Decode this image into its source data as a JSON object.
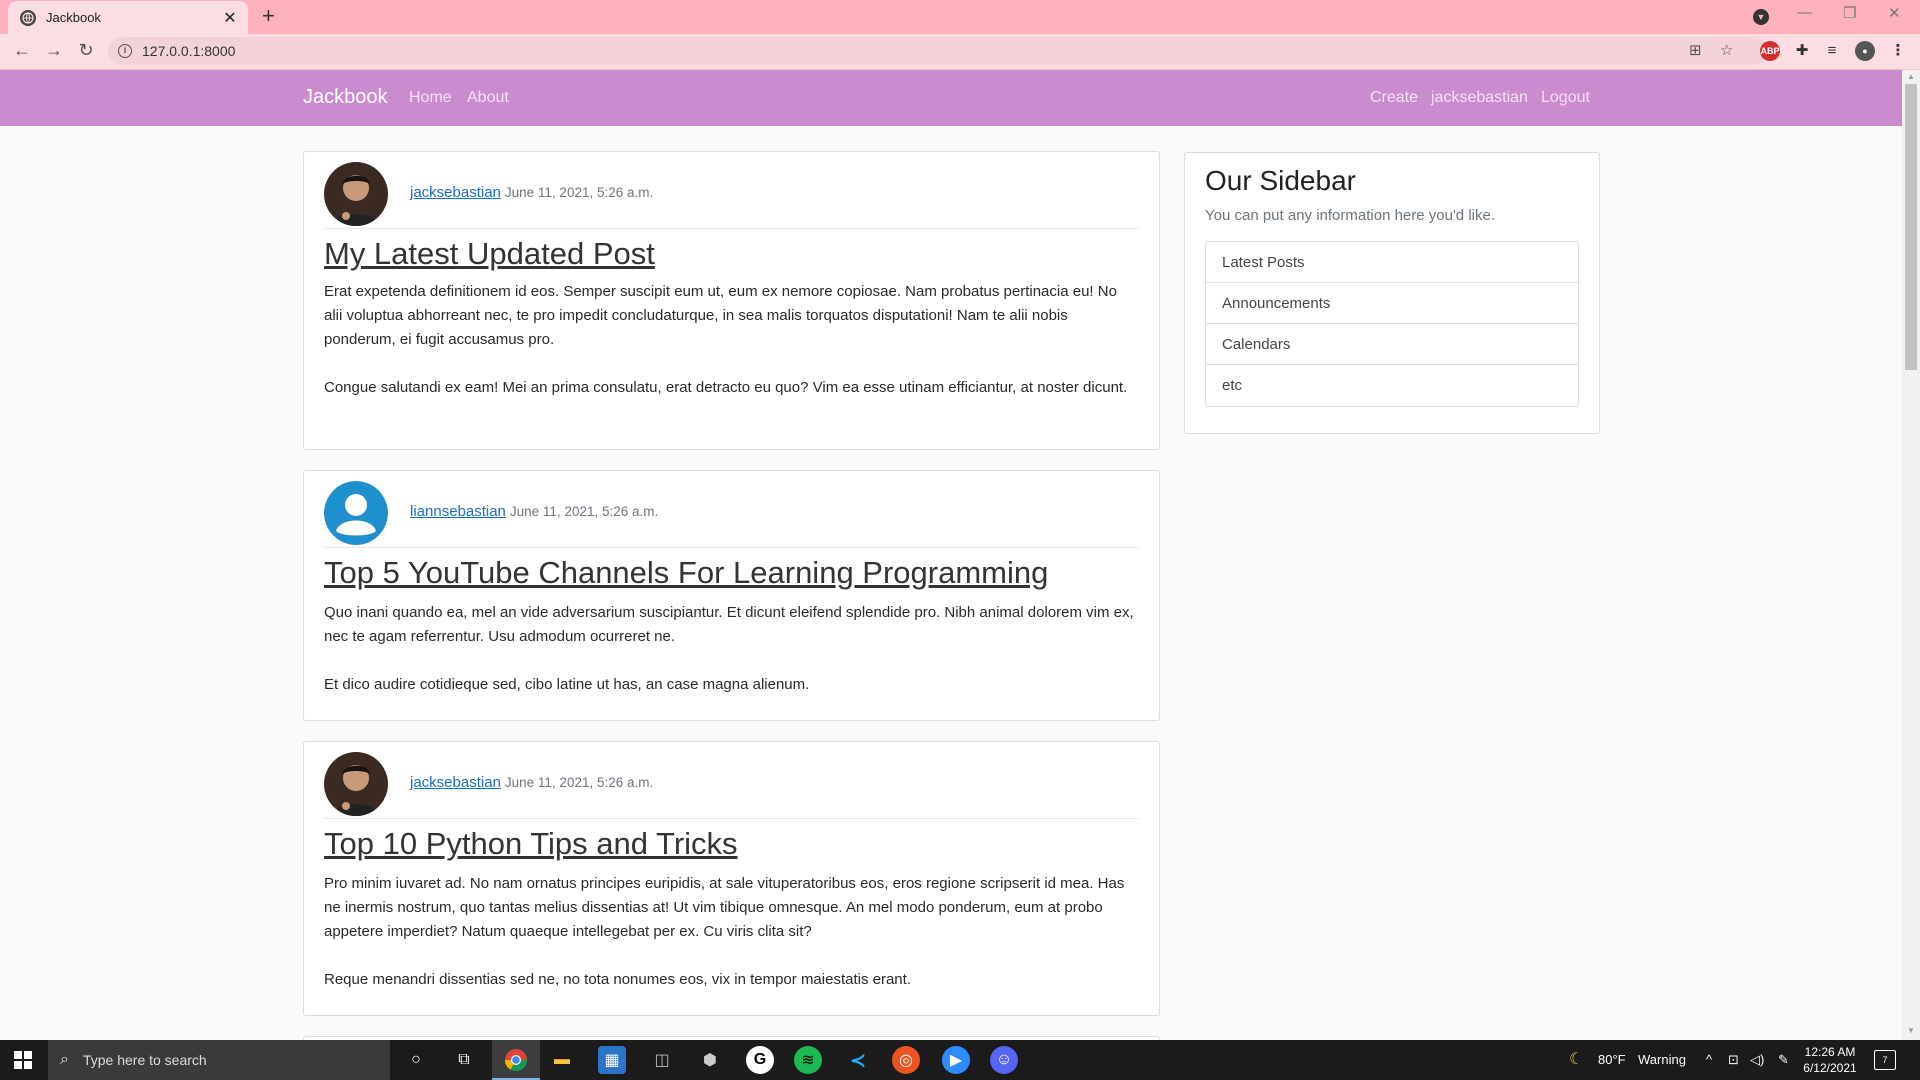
{
  "browser": {
    "tab_title": "Jackbook",
    "url": "127.0.0.1:8000"
  },
  "navbar": {
    "brand": "Jackbook",
    "left_links": [
      "Home",
      "About"
    ],
    "right_links": [
      "Create",
      "jacksebastian",
      "Logout"
    ],
    "background": "#cb8bcf"
  },
  "posts": [
    {
      "author": "jacksebastian",
      "date": "June 11, 2021, 5:26 a.m.",
      "avatar": "photo",
      "title": "My Latest Updated Post",
      "paragraphs": [
        "Erat expetenda definitionem id eos. Semper suscipit eum ut, eum ex nemore copiosae. Nam probatus pertinacia eu! No alii voluptua abhorreant nec, te pro impedit concludaturque, in sea malis torquatos disputationi! Nam te alii nobis ponderum, ei fugit accusamus pro.",
        "Congue salutandi ex eam! Mei an prima consulatu, erat detracto eu quo? Vim ea esse utinam efficiantur, at noster dicunt."
      ]
    },
    {
      "author": "liannsebastian",
      "date": "June 11, 2021, 5:26 a.m.",
      "avatar": "default-user",
      "title": "Top 5 YouTube Channels For Learning Programming",
      "paragraphs": [
        "Quo inani quando ea, mel an vide adversarium suscipiantur. Et dicunt eleifend splendide pro. Nibh animal dolorem vim ex, nec te agam referrentur. Usu admodum ocurreret ne.",
        "Et dico audire cotidieque sed, cibo latine ut has, an case magna alienum."
      ]
    },
    {
      "author": "jacksebastian",
      "date": "June 11, 2021, 5:26 a.m.",
      "avatar": "photo",
      "title": "Top 10 Python Tips and Tricks",
      "paragraphs": [
        "Pro minim iuvaret ad. No nam ornatus principes euripidis, at sale vituperatoribus eos, eros regione scripserit id mea. Has ne inermis nostrum, quo tantas melius dissentias at! Ut vim tibique omnesque. An mel modo ponderum, eum at probo appetere imperdiet? Natum quaeque intellegebat per ex. Cu viris clita sit?",
        "Reque menandri dissentias sed ne, no tota nonumes eos, vix in tempor maiestatis erant."
      ]
    }
  ],
  "sidebar": {
    "title": "Our Sidebar",
    "subtitle": "You can put any information here you'd like.",
    "items": [
      "Latest Posts",
      "Announcements",
      "Calendars",
      "etc"
    ]
  },
  "taskbar": {
    "search_placeholder": "Type here to search",
    "weather": "80°F",
    "weather_status": "Warning",
    "time": "12:26 AM",
    "date": "6/12/2021",
    "notifications": "7"
  }
}
